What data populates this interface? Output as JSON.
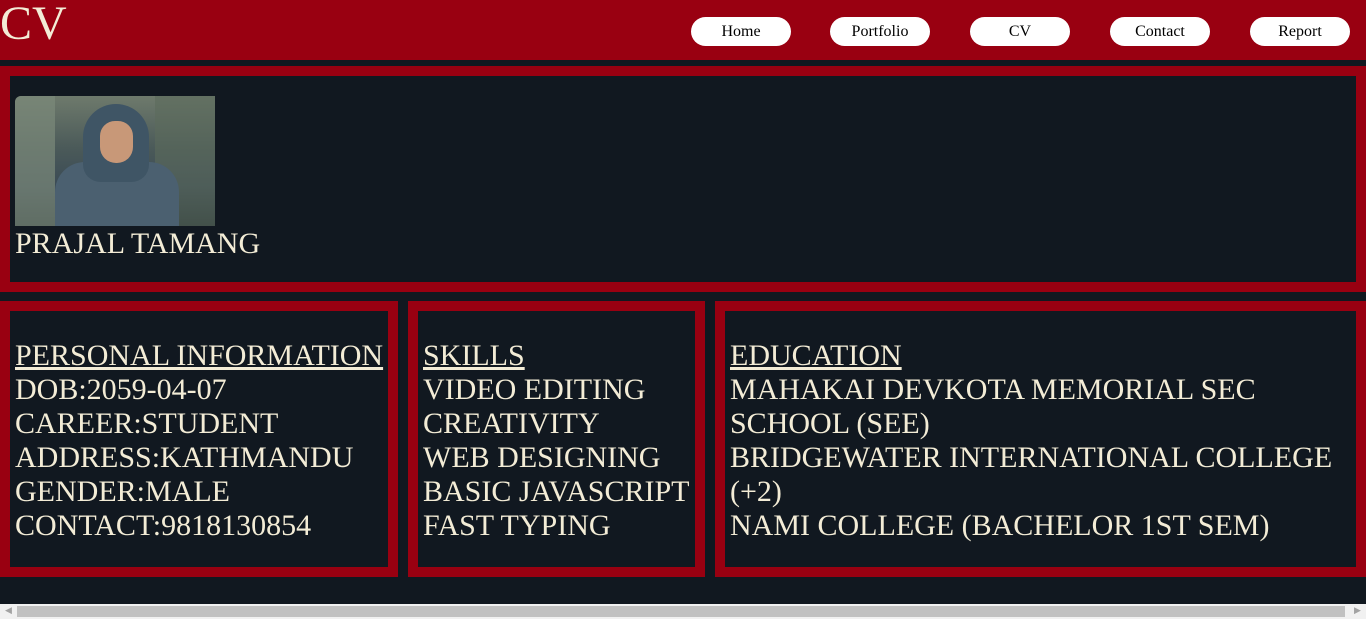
{
  "header": {
    "logo": "CV",
    "nav": [
      "Home",
      "Portfolio",
      "CV",
      "Contact",
      "Report"
    ]
  },
  "profile": {
    "name": "PRAJAL TAMANG"
  },
  "personal": {
    "heading": "PERSONAL INFORMATION",
    "items": [
      "DOB:2059-04-07",
      "CAREER:STUDENT",
      "ADDRESS:KATHMANDU",
      "GENDER:MALE",
      "CONTACT:9818130854"
    ]
  },
  "skills": {
    "heading": "SKILLS",
    "items": [
      "VIDEO EDITING",
      "CREATIVITY",
      "WEB DESIGNING",
      "BASIC JAVASCRIPT",
      "FAST TYPING"
    ]
  },
  "education": {
    "heading": "EDUCATION",
    "items": [
      "MAHAKAI DEVKOTA MEMORIAL SEC SCHOOL (SEE)",
      "BRIDGEWATER INTERNATIONAL COLLEGE (+2)",
      "NAMI COLLEGE (BACHELOR 1ST SEM)"
    ]
  },
  "colors": {
    "accent": "#990011",
    "background": "#111820",
    "text": "#f3ecd6"
  },
  "scrollbar": {
    "left_icon": "arrow-left-icon",
    "right_icon": "arrow-right-icon"
  }
}
